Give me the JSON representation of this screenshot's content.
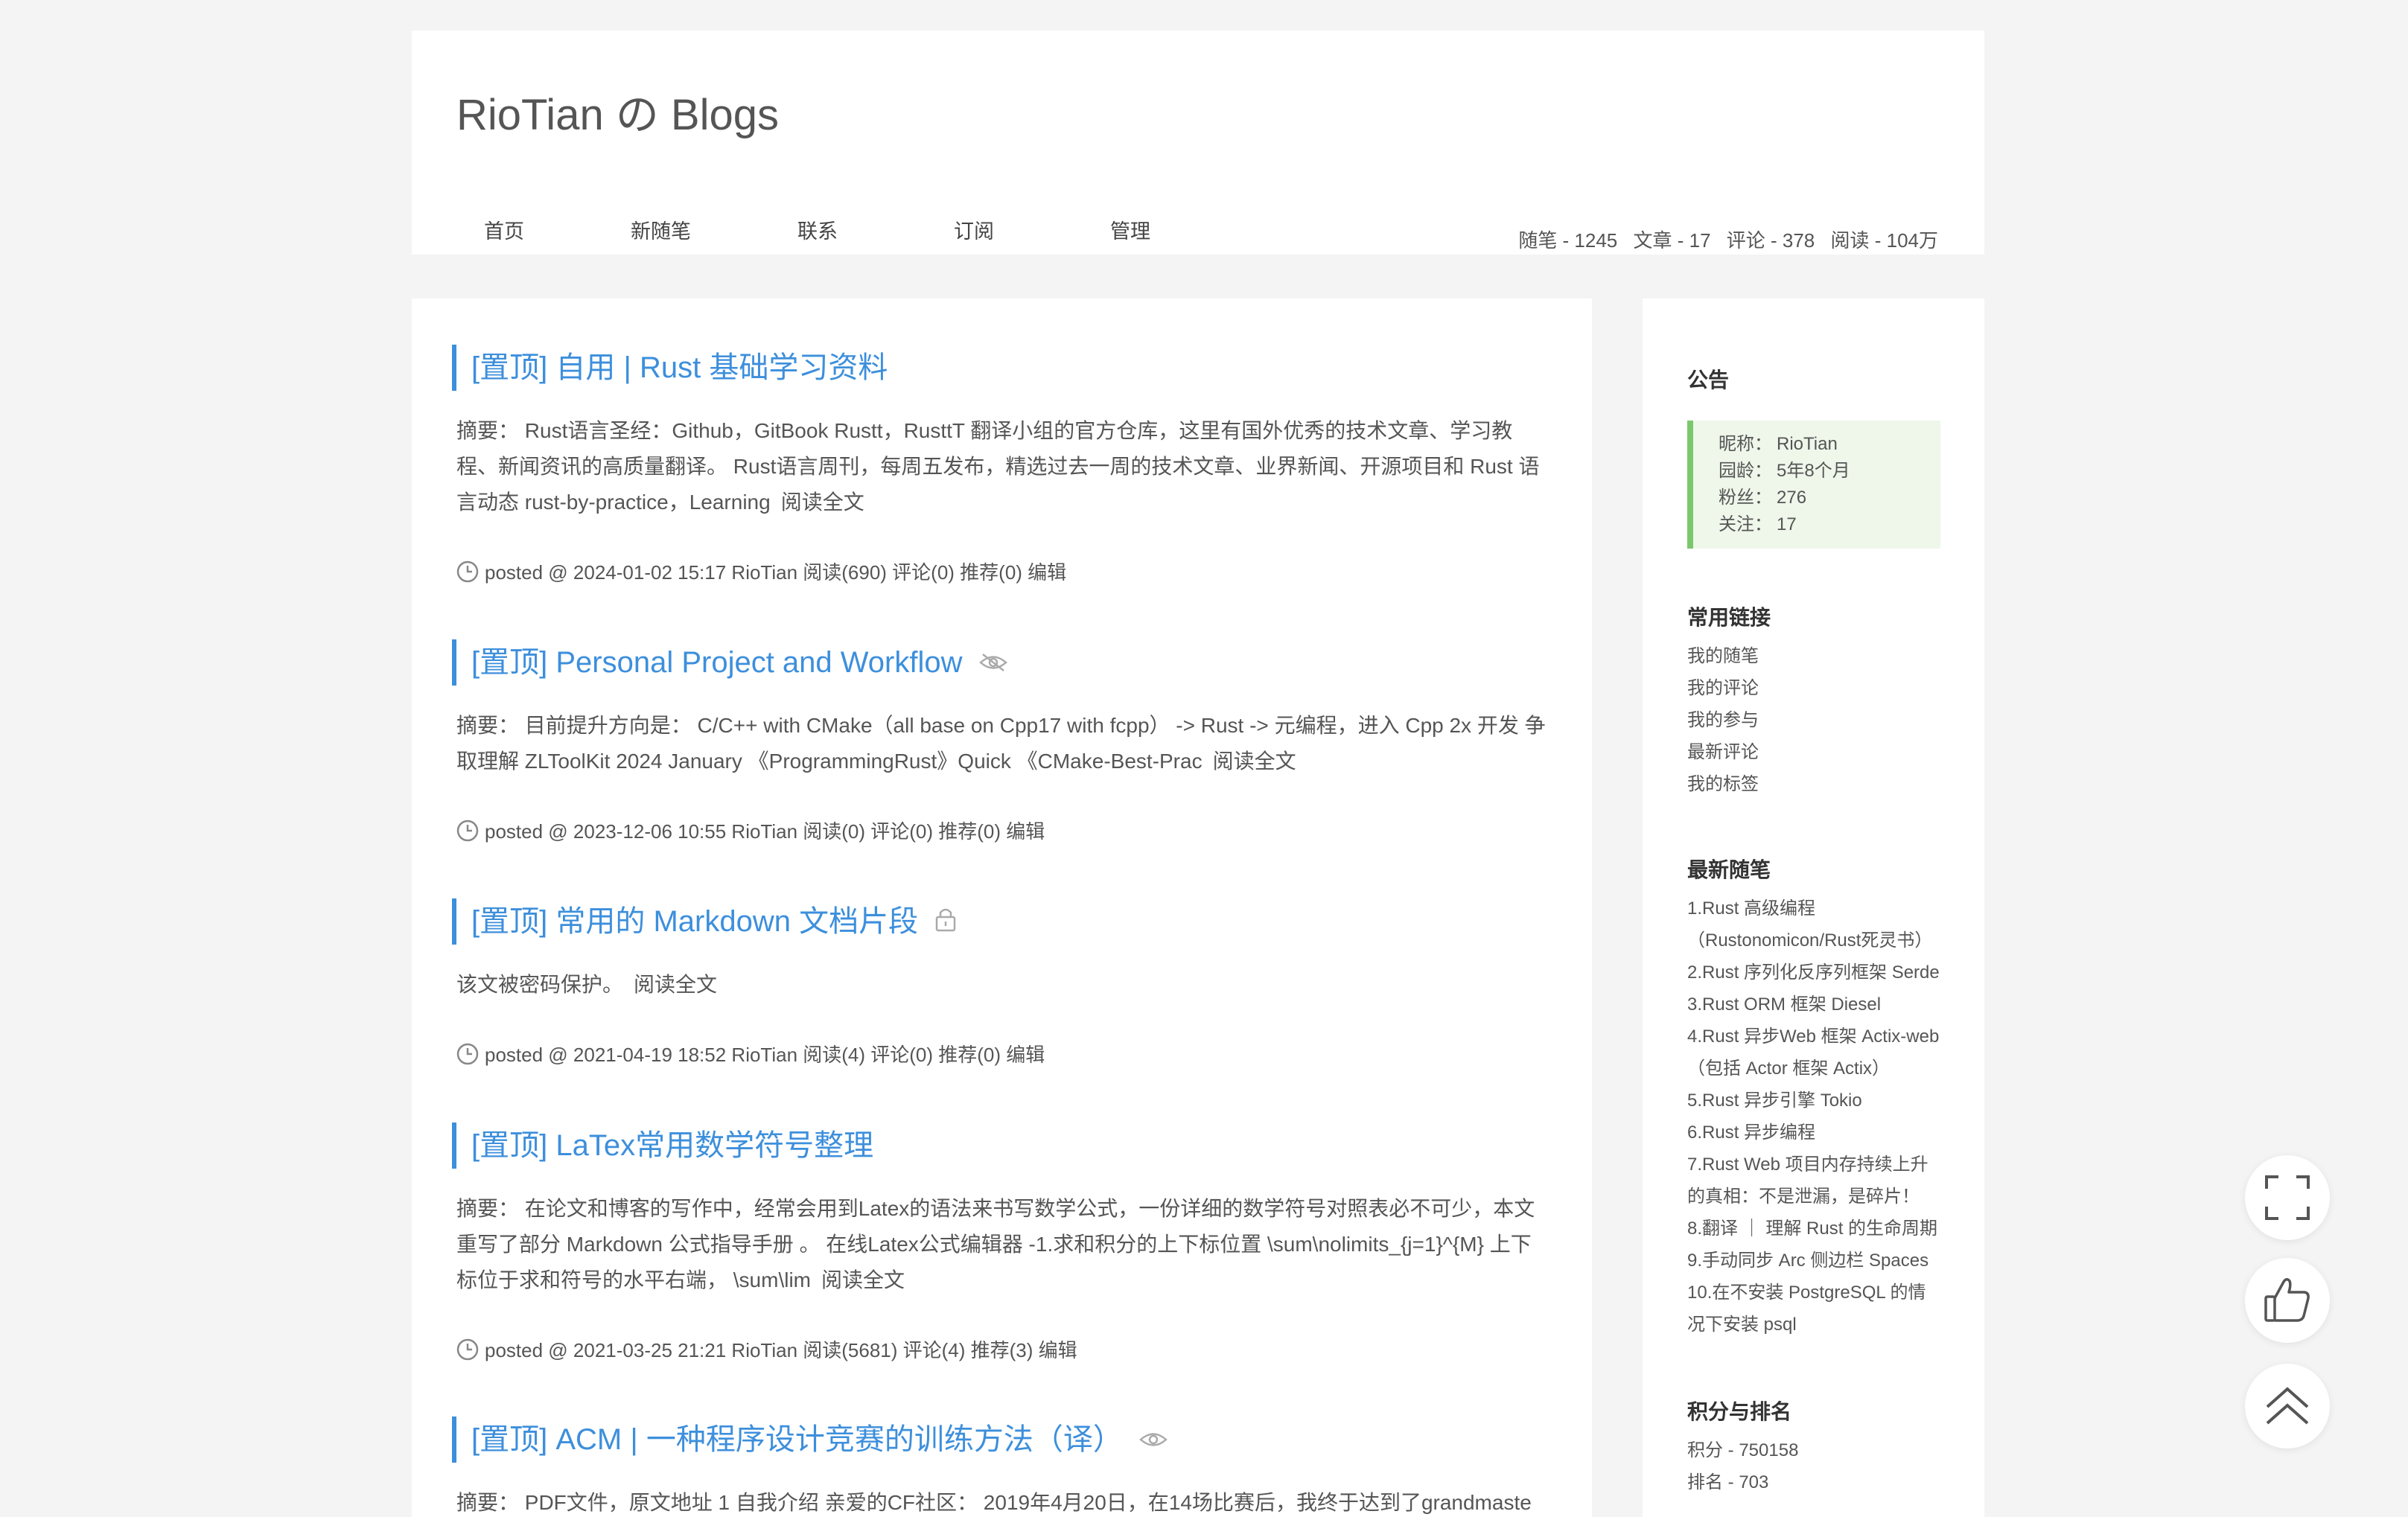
{
  "header": {
    "title": "RioTian の Blogs",
    "nav": [
      "首页",
      "新随笔",
      "联系",
      "订阅",
      "管理"
    ],
    "stats": [
      "随笔 - 1245",
      "文章 - 17",
      "评论 - 378",
      "阅读 - 104万"
    ]
  },
  "posts": [
    {
      "title": "[置顶] 自用 | Rust 基础学习资料",
      "summary": "摘要： Rust语言圣经：Github，GitBook Rustt，RusttT 翻译小组的官方仓库，这里有国外优秀的技术文章、学习教程、新闻资讯的高质量翻译。 Rust语言周刊，每周五发布，精选过去一周的技术文章、业界新闻、开源项目和 Rust 语言动态 rust-by-practice，Learning",
      "more": "阅读全文",
      "meta": "posted @ 2024-01-02 15:17 RioTian 阅读(690) 评论(0) 推荐(0) 编辑",
      "icon": ""
    },
    {
      "title": "[置顶] Personal Project and Workflow",
      "summary": "摘要： 目前提升方向是： C/C++ with CMake（all base on Cpp17 with fcpp） -> Rust -> 元编程，进入 Cpp 2x 开发 争取理解 ZLToolKit 2024 January 《ProgrammingRust》Quick 《CMake-Best-Prac",
      "more": "阅读全文",
      "meta": "posted @ 2023-12-06 10:55 RioTian 阅读(0) 评论(0) 推荐(0) 编辑",
      "icon": "eye-slash-icon"
    },
    {
      "title": "[置顶] 常用的 Markdown 文档片段",
      "summary": "该文被密码保护。",
      "more": "阅读全文",
      "meta": "posted @ 2021-04-19 18:52 RioTian 阅读(4) 评论(0) 推荐(0) 编辑",
      "icon": "lock-icon"
    },
    {
      "title": "[置顶] LaTex常用数学符号整理",
      "summary": "摘要： 在论文和博客的写作中，经常会用到Latex的语法来书写数学公式，一份详细的数学符号对照表必不可少，本文重写了部分 Markdown 公式指导手册 。 在线Latex公式编辑器 -1.求和积分的上下标位置 \\sum\\nolimits_{j=1}^{M} 上下标位于求和符号的水平右端， \\sum\\lim",
      "more": "阅读全文",
      "meta": "posted @ 2021-03-25 21:21 RioTian 阅读(5681) 评论(4) 推荐(3) 编辑",
      "icon": ""
    },
    {
      "title": "[置顶] ACM | 一种程序设计竞赛的训练方法（译）",
      "summary": "摘要： PDF文件，原文地址 1 自我介绍 亲爱的CF社区： 2019年4月20日，在14场比赛后，我终于达到了grandmaste",
      "more": "",
      "meta": "",
      "icon": "eye-icon"
    }
  ],
  "sidebar": {
    "notice_title": "公告",
    "notice": [
      {
        "k": "昵称：",
        "v": "RioTian"
      },
      {
        "k": "园龄：",
        "v": "5年8个月"
      },
      {
        "k": "粉丝：",
        "v": "276"
      },
      {
        "k": "关注：",
        "v": "17"
      }
    ],
    "links_title": "常用链接",
    "links": [
      "我的随笔",
      "我的评论",
      "我的参与",
      "最新评论",
      "我的标签"
    ],
    "latest_title": "最新随笔",
    "latest": [
      "1.Rust 高级编程",
      "（Rustonomicon/Rust死灵书）",
      "2.Rust 序列化反序列框架 Serde",
      "3.Rust ORM 框架 Diesel",
      "4.Rust 异步Web 框架 Actix-web",
      "（包括 Actor 框架 Actix）",
      "5.Rust 异步引擎 Tokio",
      "6.Rust 异步编程",
      "7.Rust Web 项目内存持续上升",
      "的真相：不是泄漏，是碎片！",
      "8.翻译 ｜ 理解 Rust 的生命周期",
      "9.手动同步 Arc 侧边栏 Spaces",
      "10.在不安装 PostgreSQL 的情",
      "况下安装 psql"
    ],
    "score_title": "积分与排名",
    "score": [
      "积分 - 750158",
      "排名 - 703"
    ]
  }
}
